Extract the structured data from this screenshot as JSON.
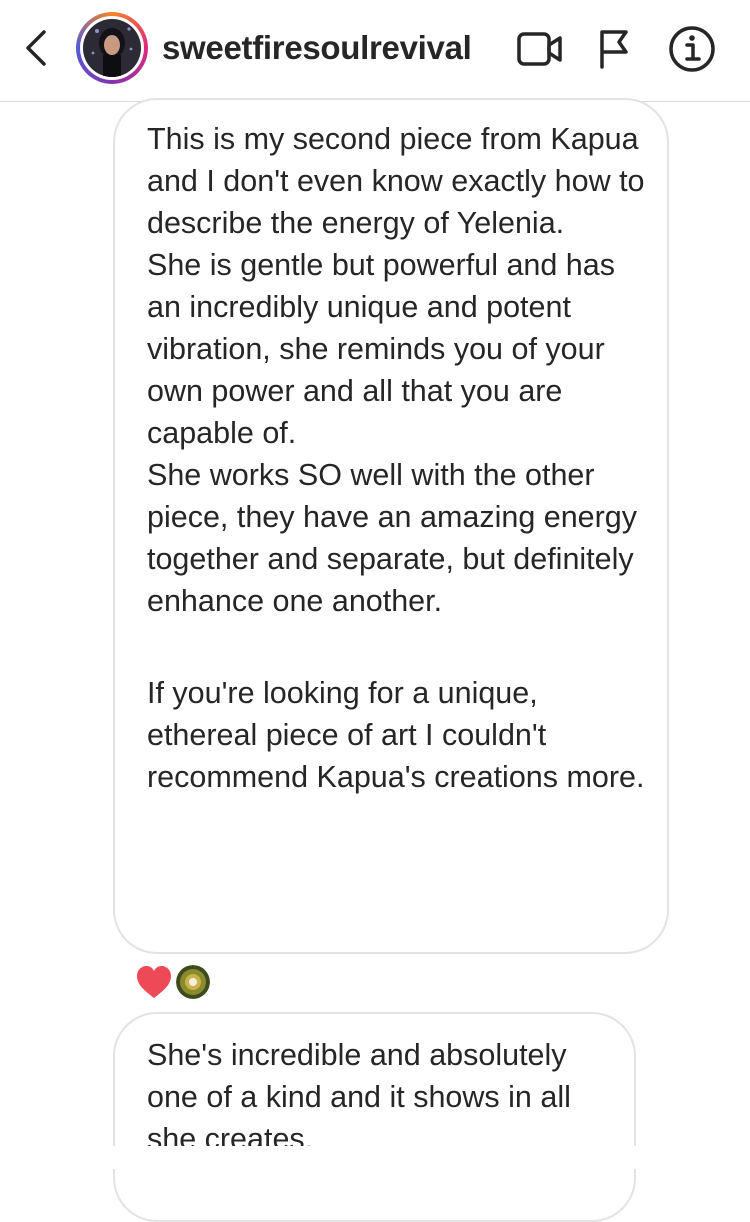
{
  "header": {
    "username": "sweetfiresoulrevival",
    "icons": [
      "back-chevron-icon",
      "video-call-icon",
      "flag-icon",
      "info-icon"
    ]
  },
  "messages": [
    {
      "paragraphs": [
        "This is my second piece from Kapua and I don't even know exactly how to describe the energy of Yelenia.",
        "She is gentle but powerful and has an incredibly unique and potent vibration, she reminds you of your own power and all that you are capable of.",
        "She works SO well with the other piece, they have an amazing energy together and separate, but definitely enhance one another.",
        "If you're looking for a unique, ethereal piece of art I couldn't recommend Kapua's creations more."
      ],
      "reactions": [
        "heart-reaction-icon",
        "reactor-avatar"
      ]
    },
    {
      "paragraphs": [
        "She's incredible and absolutely one of a kind and it shows in all she creates."
      ]
    }
  ],
  "colors": {
    "text": "#262626",
    "bubble_border": "#e3e3e3",
    "heart": "#ed4956",
    "header_border": "#dbdbdb"
  }
}
